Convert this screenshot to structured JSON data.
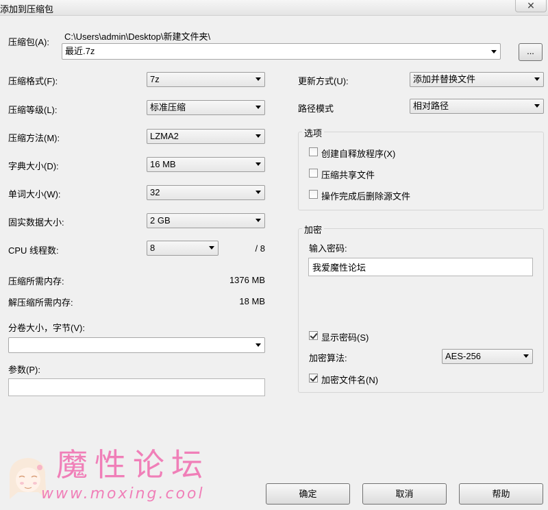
{
  "window": {
    "title": "添加到压缩包",
    "close_glyph": "✕"
  },
  "archive": {
    "label": "压缩包(A):",
    "path": "C:\\Users\\admin\\Desktop\\新建文件夹\\",
    "name": "最近.7z",
    "browse_label": "..."
  },
  "left_fields": [
    {
      "label": "压缩格式(F):",
      "value": "7z"
    },
    {
      "label": "压缩等级(L):",
      "value": "标准压缩"
    },
    {
      "label": "压缩方法(M):",
      "value": "LZMA2"
    },
    {
      "label": "字典大小(D):",
      "value": "16 MB"
    },
    {
      "label": "单词大小(W):",
      "value": "32"
    },
    {
      "label": "固实数据大小:",
      "value": "2 GB"
    }
  ],
  "cpu": {
    "label": "CPU 线程数:",
    "value": "8",
    "total": "/ 8"
  },
  "memory": {
    "compress_label": "压缩所需内存:",
    "compress_value": "1376 MB",
    "decompress_label": "解压缩所需内存:",
    "decompress_value": "18 MB"
  },
  "volume": {
    "label": "分卷大小，字节(V):",
    "value": ""
  },
  "params": {
    "label": "参数(P):",
    "value": ""
  },
  "update": {
    "label": "更新方式(U):",
    "value": "添加并替换文件"
  },
  "path_mode": {
    "label": "路径模式",
    "value": "相对路径"
  },
  "options": {
    "title": "选项",
    "items": [
      {
        "label": "创建自释放程序(X)",
        "checked": false
      },
      {
        "label": "压缩共享文件",
        "checked": false
      },
      {
        "label": "操作完成后删除源文件",
        "checked": false
      }
    ]
  },
  "encryption": {
    "title": "加密",
    "password_label": "输入密码:",
    "password_value": "我爱魔性论坛",
    "show_password_label": "显示密码(S)",
    "show_password_checked": true,
    "method_label": "加密算法:",
    "method_value": "AES-256",
    "encrypt_names_label": "加密文件名(N)",
    "encrypt_names_checked": true
  },
  "buttons": {
    "ok": "确定",
    "cancel": "取消",
    "help": "帮助"
  },
  "watermark": {
    "title": "魔性论坛",
    "url": "www.moxing.cool"
  }
}
